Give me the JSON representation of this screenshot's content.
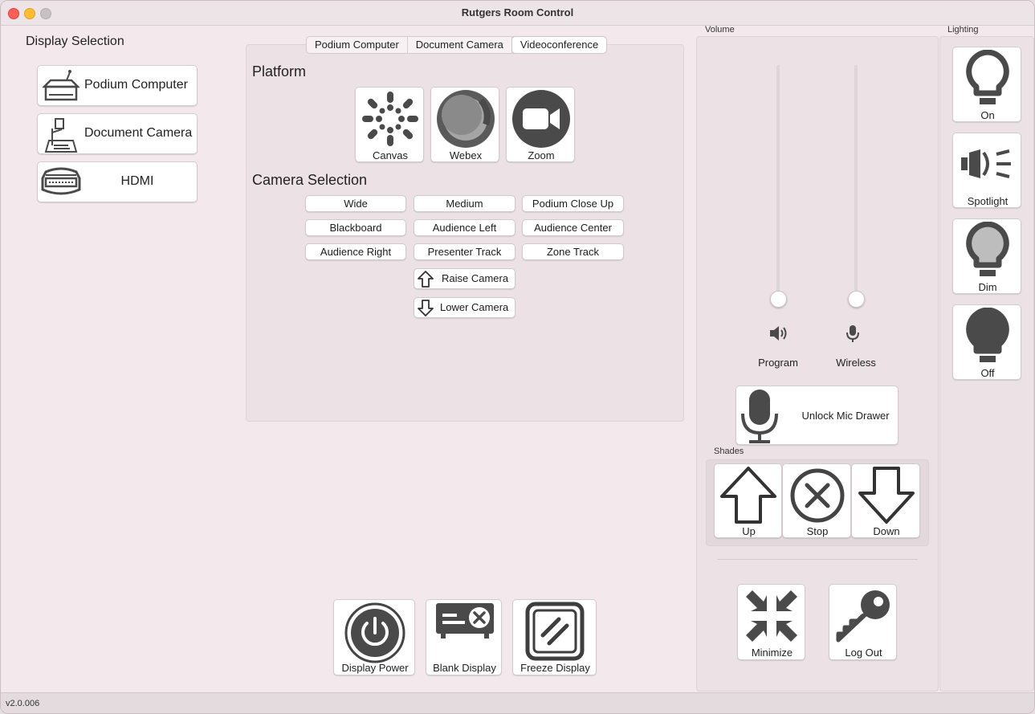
{
  "window": {
    "title": "Rutgers Room Control"
  },
  "display_selection": {
    "title": "Display Selection",
    "items": [
      {
        "label": "Podium Computer",
        "icon": "podium-icon"
      },
      {
        "label": "Document Camera",
        "icon": "document-camera-icon"
      },
      {
        "label": "HDMI",
        "icon": "hdmi-icon"
      }
    ]
  },
  "tabs": [
    {
      "label": "Podium Computer",
      "active": false
    },
    {
      "label": "Document Camera",
      "active": false
    },
    {
      "label": "Videoconference",
      "active": true
    }
  ],
  "platform": {
    "title": "Platform",
    "items": [
      {
        "label": "Canvas",
        "icon": "canvas-icon"
      },
      {
        "label": "Webex",
        "icon": "webex-icon"
      },
      {
        "label": "Zoom",
        "icon": "zoom-icon"
      }
    ]
  },
  "camera_selection": {
    "title": "Camera Selection",
    "presets": [
      "Wide",
      "Medium",
      "Podium Close Up",
      "Blackboard",
      "Audience Left",
      "Audience Center",
      "Audience Right",
      "Presenter Track",
      "Zone Track"
    ],
    "raise_label": "Raise Camera",
    "lower_label": "Lower Camera"
  },
  "bottom_actions": [
    {
      "label": "Display Power",
      "icon": "power-icon"
    },
    {
      "label": "Blank Display",
      "icon": "projector-blank-icon"
    },
    {
      "label": "Freeze Display",
      "icon": "freeze-icon"
    }
  ],
  "volume": {
    "title": "Volume",
    "channels": [
      {
        "label": "Program",
        "icon": "speaker-icon",
        "level": 0
      },
      {
        "label": "Wireless",
        "icon": "microphone-icon",
        "level": 0
      }
    ]
  },
  "mic_drawer": {
    "label": "Unlock Mic Drawer",
    "icon": "microphone-icon"
  },
  "shades": {
    "title": "Shades",
    "items": [
      {
        "label": "Up",
        "icon": "arrow-up-icon"
      },
      {
        "label": "Stop",
        "icon": "stop-icon"
      },
      {
        "label": "Down",
        "icon": "arrow-down-icon"
      }
    ]
  },
  "system": {
    "minimize_label": "Minimize",
    "logout_label": "Log Out"
  },
  "lighting": {
    "title": "Lighting",
    "items": [
      {
        "label": "On",
        "icon": "bulb-on-icon"
      },
      {
        "label": "Spotlight",
        "icon": "spotlight-icon"
      },
      {
        "label": "Dim",
        "icon": "bulb-dim-icon"
      },
      {
        "label": "Off",
        "icon": "bulb-off-icon"
      }
    ]
  },
  "footer": {
    "version": "v2.0.006"
  }
}
